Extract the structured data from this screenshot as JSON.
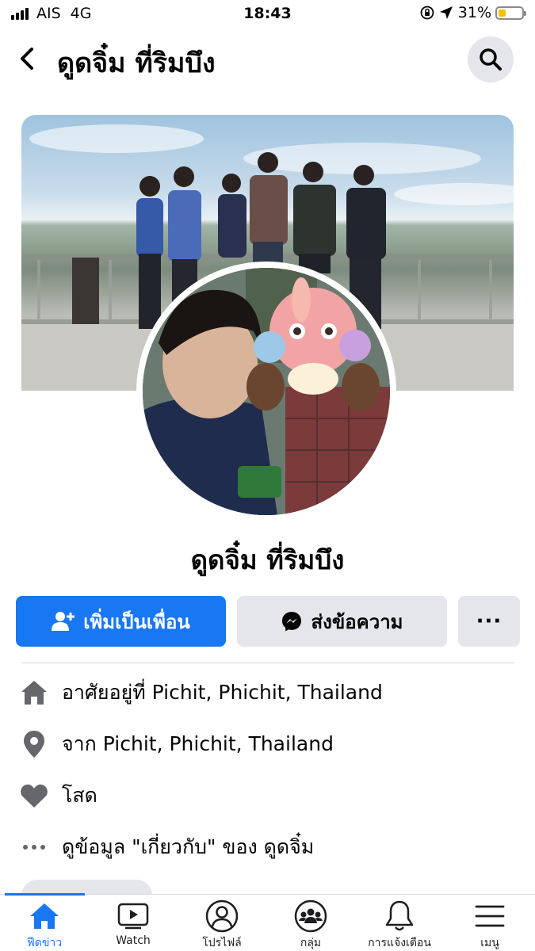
{
  "status_bar": {
    "carrier": "AIS",
    "network": "4G",
    "time": "18:43",
    "battery_percent": "31%",
    "battery_level": 0.31
  },
  "header": {
    "title": "ดูดจิ๋ม ที่ริมบึง",
    "back_icon": "chevron-left-icon",
    "search_icon": "search-icon"
  },
  "profile": {
    "name": "ดูดจิ๋ม ที่ริมบึง"
  },
  "actions": {
    "add_friend_label": "เพิ่มเป็นเพื่อน",
    "message_label": "ส่งข้อความ",
    "more_label": "···"
  },
  "info": [
    {
      "icon": "home-icon",
      "text": "อาศัยอยู่ที่ Pichit, Phichit, Thailand"
    },
    {
      "icon": "location-pin-icon",
      "text": "จาก Pichit, Phichit, Thailand"
    },
    {
      "icon": "heart-icon",
      "text": "โสด"
    },
    {
      "icon": "more-dots-icon",
      "text": "ดูข้อมูล \"เกี่ยวกับ\" ของ ดูดจิ๋ม"
    }
  ],
  "tabs": [
    {
      "label": "ฟีดข่าว",
      "icon": "home-icon",
      "active": true
    },
    {
      "label": "Watch",
      "icon": "video-icon",
      "active": false
    },
    {
      "label": "โปรไฟล์",
      "icon": "profile-icon",
      "active": false
    },
    {
      "label": "กลุ่ม",
      "icon": "groups-icon",
      "active": false
    },
    {
      "label": "การแจ้งเตือน",
      "icon": "bell-icon",
      "active": false
    },
    {
      "label": "เมนู",
      "icon": "menu-icon",
      "active": false
    }
  ],
  "colors": {
    "accent": "#1877f2",
    "button_gray": "#e4e6eb",
    "icon_gray": "#65676b"
  }
}
